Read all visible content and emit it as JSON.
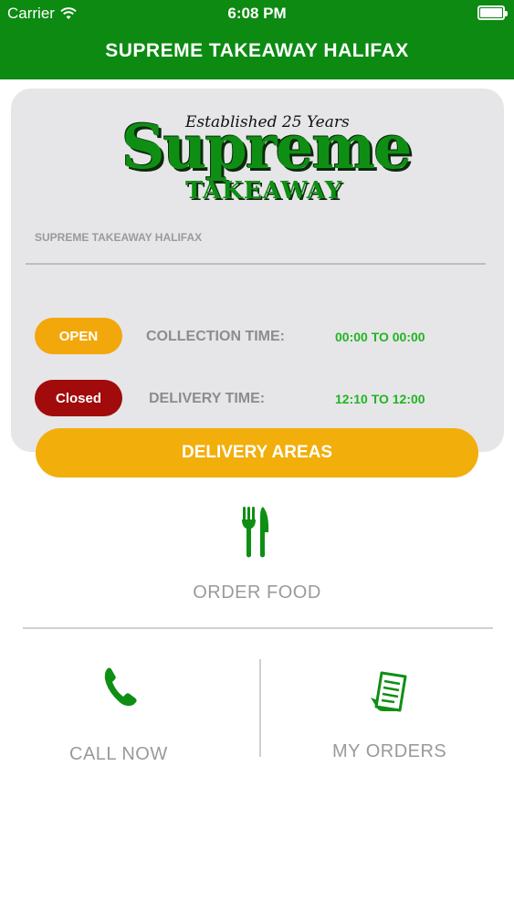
{
  "status_bar": {
    "carrier": "Carrier",
    "time": "6:08 PM",
    "wifi_icon": "wifi-icon",
    "battery_icon": "battery-icon"
  },
  "header": {
    "title": "SUPREME TAKEAWAY HALIFAX",
    "background_color": "#0c8a12"
  },
  "logo": {
    "tagline": "Established 25 Years",
    "name": "Supreme",
    "subtitle": "TAKEAWAY"
  },
  "store": {
    "name": "SUPREME TAKEAWAY HALIFAX"
  },
  "collection": {
    "status": "OPEN",
    "status_color": "#f2a80a",
    "label": "COLLECTION TIME:",
    "time": "00:00 TO 00:00"
  },
  "delivery": {
    "status": "Closed",
    "status_color": "#a10b0b",
    "label": "DELIVERY TIME:",
    "time": "12:10 TO 12:00"
  },
  "delivery_areas_button": {
    "label": "DELIVERY AREAS",
    "color": "#f2ae0b"
  },
  "actions": {
    "order_food": {
      "label": "ORDER FOOD",
      "icon": "fork-knife-icon"
    },
    "call_now": {
      "label": "CALL NOW",
      "icon": "phone-icon"
    },
    "my_orders": {
      "label": "MY ORDERS",
      "icon": "receipt-icon"
    }
  },
  "colors": {
    "accent_green": "#0e8f14",
    "time_green": "#22b422",
    "muted_text": "#9a9a9a"
  }
}
